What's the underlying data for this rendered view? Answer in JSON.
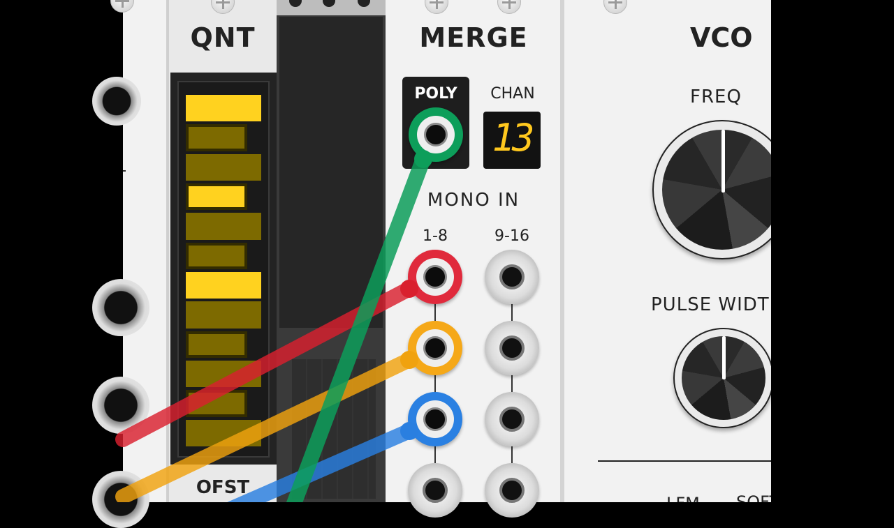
{
  "modules": {
    "qnt": {
      "title": "QNT",
      "offset_label": "OFST",
      "key_colors": {
        "on": "#ffd21f",
        "off": "#7d6a00"
      },
      "keys": [
        {
          "type": "white",
          "active": false
        },
        {
          "type": "black",
          "active": false
        },
        {
          "type": "white",
          "active": false
        },
        {
          "type": "black",
          "active": false
        },
        {
          "type": "white",
          "active": false
        },
        {
          "type": "white",
          "active": true
        },
        {
          "type": "black",
          "active": false
        },
        {
          "type": "white",
          "active": false
        },
        {
          "type": "black",
          "active": true
        },
        {
          "type": "white",
          "active": false
        },
        {
          "type": "black",
          "active": false
        },
        {
          "type": "white",
          "active": true
        }
      ]
    },
    "merge": {
      "title": "MERGE",
      "poly_label": "POLY",
      "chan_label": "CHAN",
      "channel_value": "13",
      "mono_in_label": "MONO IN",
      "col1_label": "1-8",
      "col2_label": "9-16"
    },
    "vco": {
      "title": "VCO",
      "freq_label": "FREQ",
      "pulse_width_label": "PULSE WIDTH",
      "bottom_labels": [
        "LFM",
        "SOFT"
      ]
    }
  },
  "cables": [
    {
      "name": "green-cable",
      "color": "#0d9e5a",
      "from": "merge-poly-out"
    },
    {
      "name": "red-cable",
      "color": "#d9202e",
      "to": "merge-in-1"
    },
    {
      "name": "orange-cable",
      "color": "#f0a20f",
      "to": "merge-in-2"
    },
    {
      "name": "blue-cable",
      "color": "#2a7fe0",
      "to": "merge-in-3"
    }
  ],
  "colors": {
    "panel": "#f2f2f2",
    "screen": "#2a2a2a",
    "seven_segment": "#ffc81e",
    "background": "#000000"
  }
}
